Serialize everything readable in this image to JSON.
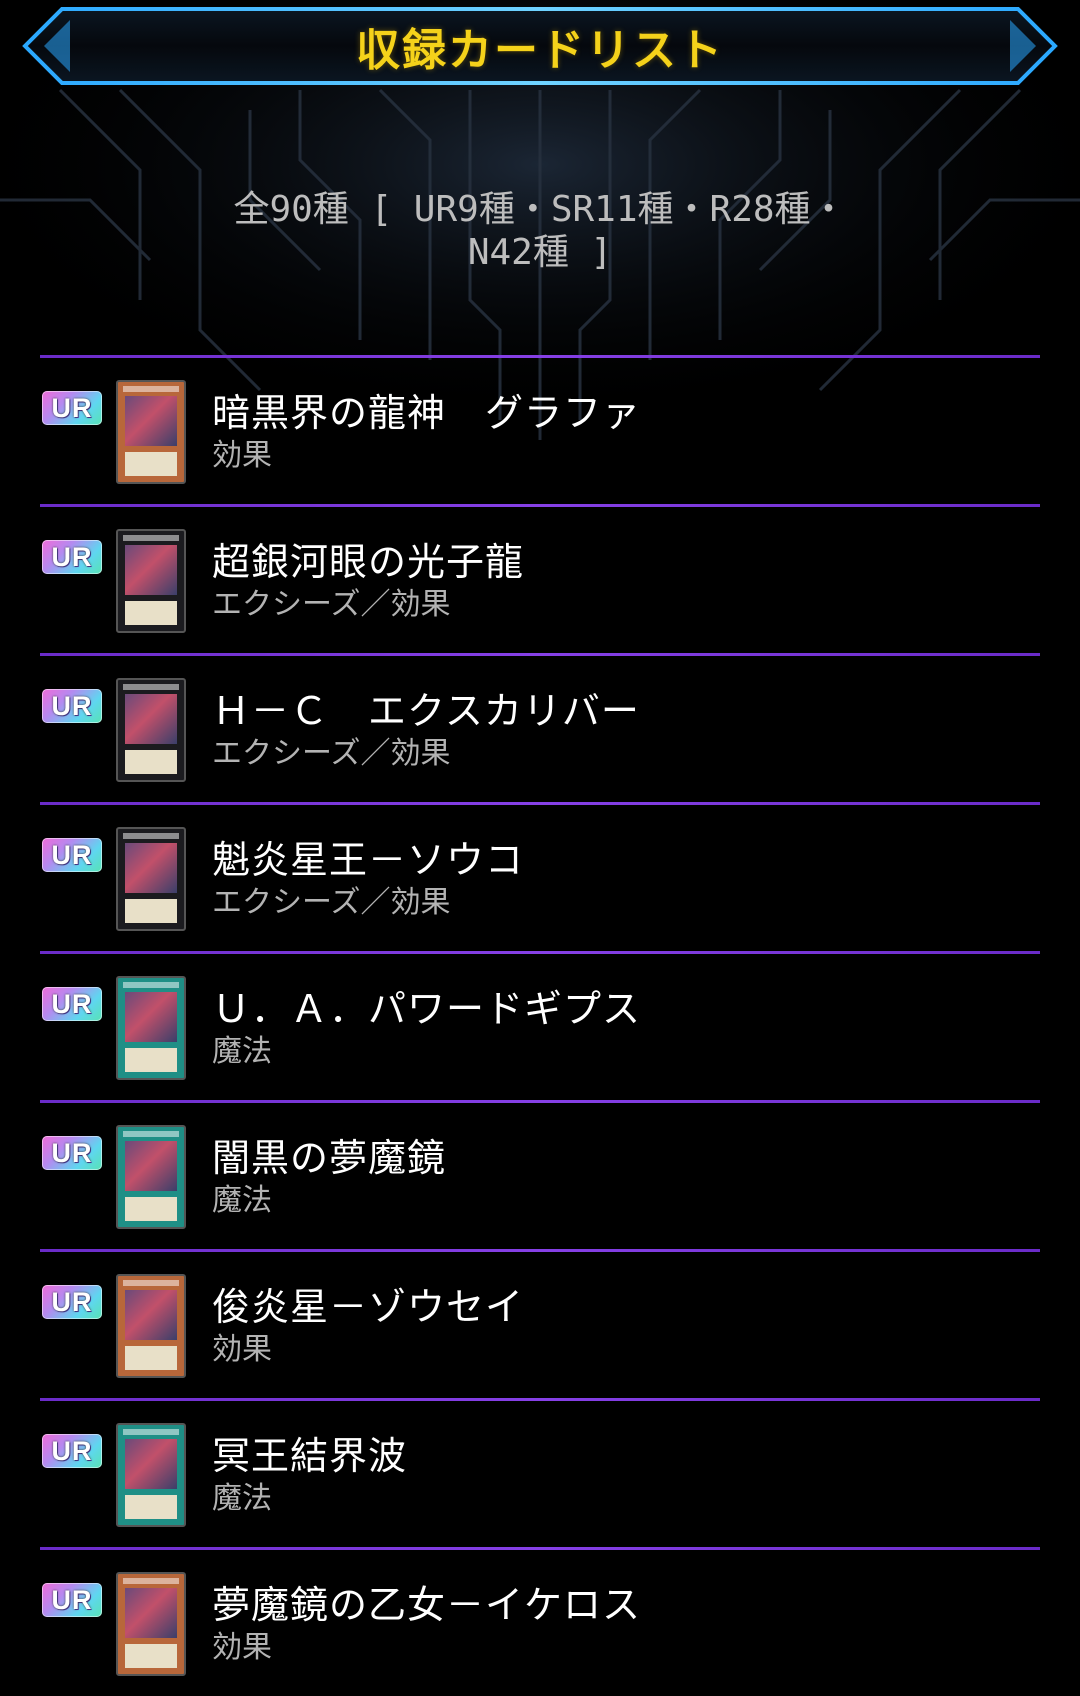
{
  "header": {
    "title": "収録カードリスト"
  },
  "summary": {
    "line1": "全90種 [ UR9種・SR11種・R28種・",
    "line2": "N42種 ]"
  },
  "cards": [
    {
      "rarity": "UR",
      "name": "暗黒界の龍神　グラファ",
      "type": "効果",
      "frame": "effect"
    },
    {
      "rarity": "UR",
      "name": "超銀河眼の光子龍",
      "type": "エクシーズ／効果",
      "frame": "xyz"
    },
    {
      "rarity": "UR",
      "name": "Ｈ－Ｃ　エクスカリバー",
      "type": "エクシーズ／効果",
      "frame": "xyz"
    },
    {
      "rarity": "UR",
      "name": "魁炎星王－ソウコ",
      "type": "エクシーズ／効果",
      "frame": "xyz"
    },
    {
      "rarity": "UR",
      "name": "Ｕ．Ａ．パワードギプス",
      "type": "魔法",
      "frame": "spell"
    },
    {
      "rarity": "UR",
      "name": "闇黒の夢魔鏡",
      "type": "魔法",
      "frame": "spell"
    },
    {
      "rarity": "UR",
      "name": "俊炎星－ゾウセイ",
      "type": "効果",
      "frame": "effect"
    },
    {
      "rarity": "UR",
      "name": "冥王結界波",
      "type": "魔法",
      "frame": "spell"
    },
    {
      "rarity": "UR",
      "name": "夢魔鏡の乙女－イケロス",
      "type": "効果",
      "frame": "effect"
    }
  ],
  "colors": {
    "frame_effect": "#b8673a",
    "frame_xyz": "#1b1b1f",
    "frame_spell": "#1f8f86"
  }
}
